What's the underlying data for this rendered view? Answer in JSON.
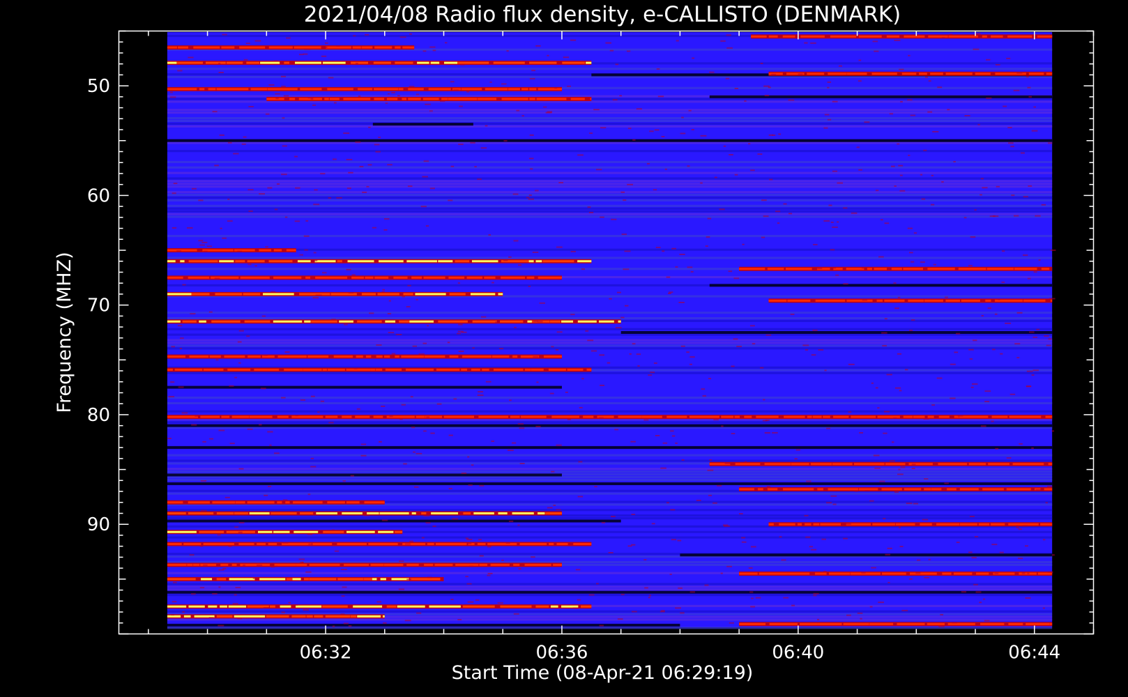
{
  "chart_data": {
    "type": "heatmap",
    "title": "2021/04/08  Radio flux density, e-CALLISTO (DENMARK)",
    "xlabel": "Start Time (08-Apr-21 06:29:19)",
    "ylabel": "Frequency (MHZ)",
    "x_ticks": [
      "06:32",
      "06:36",
      "06:40",
      "06:44"
    ],
    "x_tick_minutes": [
      32,
      36,
      40,
      44
    ],
    "xlim_minutes": [
      28.5,
      45.0
    ],
    "data_range_minutes": [
      29.32,
      44.3
    ],
    "y_ticks": [
      50,
      60,
      70,
      80,
      90
    ],
    "ylim": [
      45.0,
      100.0
    ],
    "data_range_mhz": [
      45.1,
      99.4
    ],
    "y_inverted": true,
    "colormap": [
      "#000000",
      "#0000ff",
      "#ff0000",
      "#ffff00",
      "#ffffff"
    ],
    "background_color": "#2a18ff",
    "bright_bands": [
      {
        "freq_mhz": 45.5,
        "time_range_min": [
          39.2,
          44.3
        ],
        "intensity": 0.8
      },
      {
        "freq_mhz": 46.5,
        "time_range_min": [
          29.32,
          33.5
        ],
        "intensity": 0.85
      },
      {
        "freq_mhz": 47.9,
        "time_range_min": [
          29.32,
          36.5
        ],
        "intensity": 0.95
      },
      {
        "freq_mhz": 50.3,
        "time_range_min": [
          29.32,
          36.0
        ],
        "intensity": 0.85
      },
      {
        "freq_mhz": 51.2,
        "time_range_min": [
          31.0,
          36.5
        ],
        "intensity": 0.7
      },
      {
        "freq_mhz": 48.9,
        "time_range_min": [
          39.5,
          44.3
        ],
        "intensity": 0.7
      },
      {
        "freq_mhz": 65.0,
        "time_range_min": [
          29.32,
          31.5
        ],
        "intensity": 0.85
      },
      {
        "freq_mhz": 66.0,
        "time_range_min": [
          29.32,
          36.5
        ],
        "intensity": 0.95
      },
      {
        "freq_mhz": 66.7,
        "time_range_min": [
          39.0,
          44.3
        ],
        "intensity": 0.8
      },
      {
        "freq_mhz": 67.5,
        "time_range_min": [
          29.32,
          36.0
        ],
        "intensity": 0.7
      },
      {
        "freq_mhz": 69.0,
        "time_range_min": [
          29.32,
          35.0
        ],
        "intensity": 0.9
      },
      {
        "freq_mhz": 69.6,
        "time_range_min": [
          39.5,
          44.3
        ],
        "intensity": 0.85
      },
      {
        "freq_mhz": 71.5,
        "time_range_min": [
          29.32,
          37.0
        ],
        "intensity": 0.95
      },
      {
        "freq_mhz": 74.7,
        "time_range_min": [
          29.32,
          36.0
        ],
        "intensity": 0.7
      },
      {
        "freq_mhz": 75.9,
        "time_range_min": [
          29.32,
          36.5
        ],
        "intensity": 0.85
      },
      {
        "freq_mhz": 80.2,
        "time_range_min": [
          29.32,
          44.3
        ],
        "intensity": 0.6
      },
      {
        "freq_mhz": 84.5,
        "time_range_min": [
          38.5,
          44.3
        ],
        "intensity": 0.75
      },
      {
        "freq_mhz": 86.8,
        "time_range_min": [
          39.0,
          44.3
        ],
        "intensity": 0.7
      },
      {
        "freq_mhz": 88.0,
        "time_range_min": [
          29.32,
          33.0
        ],
        "intensity": 0.7
      },
      {
        "freq_mhz": 89.0,
        "time_range_min": [
          29.32,
          36.0
        ],
        "intensity": 0.95
      },
      {
        "freq_mhz": 90.0,
        "time_range_min": [
          39.5,
          44.3
        ],
        "intensity": 0.8
      },
      {
        "freq_mhz": 90.7,
        "time_range_min": [
          29.32,
          33.3
        ],
        "intensity": 1.0
      },
      {
        "freq_mhz": 91.8,
        "time_range_min": [
          29.32,
          36.5
        ],
        "intensity": 0.75
      },
      {
        "freq_mhz": 93.7,
        "time_range_min": [
          29.32,
          36.0
        ],
        "intensity": 0.85
      },
      {
        "freq_mhz": 94.5,
        "time_range_min": [
          39.0,
          44.3
        ],
        "intensity": 0.75
      },
      {
        "freq_mhz": 95.0,
        "time_range_min": [
          29.32,
          34.0
        ],
        "intensity": 0.95
      },
      {
        "freq_mhz": 97.5,
        "time_range_min": [
          29.32,
          36.5
        ],
        "intensity": 0.9
      },
      {
        "freq_mhz": 98.4,
        "time_range_min": [
          29.32,
          33.0
        ],
        "intensity": 1.0
      },
      {
        "freq_mhz": 99.1,
        "time_range_min": [
          39.0,
          44.3
        ],
        "intensity": 0.8
      }
    ],
    "dark_bands": [
      {
        "freq_mhz": 49.0,
        "time_range_min": [
          36.5,
          44.3
        ]
      },
      {
        "freq_mhz": 51.0,
        "time_range_min": [
          38.5,
          44.3
        ]
      },
      {
        "freq_mhz": 53.5,
        "time_range_min": [
          32.8,
          34.5
        ]
      },
      {
        "freq_mhz": 55.0,
        "time_range_min": [
          29.32,
          44.3
        ]
      },
      {
        "freq_mhz": 68.2,
        "time_range_min": [
          38.5,
          44.3
        ]
      },
      {
        "freq_mhz": 72.5,
        "time_range_min": [
          37.0,
          44.3
        ]
      },
      {
        "freq_mhz": 77.5,
        "time_range_min": [
          29.32,
          36.0
        ]
      },
      {
        "freq_mhz": 81.0,
        "time_range_min": [
          29.32,
          44.3
        ]
      },
      {
        "freq_mhz": 83.0,
        "time_range_min": [
          29.32,
          44.3
        ]
      },
      {
        "freq_mhz": 85.5,
        "time_range_min": [
          29.32,
          36.0
        ]
      },
      {
        "freq_mhz": 86.3,
        "time_range_min": [
          29.32,
          44.3
        ]
      },
      {
        "freq_mhz": 89.7,
        "time_range_min": [
          29.32,
          37.0
        ]
      },
      {
        "freq_mhz": 92.8,
        "time_range_min": [
          38.0,
          44.3
        ]
      },
      {
        "freq_mhz": 96.2,
        "time_range_min": [
          29.32,
          44.3
        ]
      },
      {
        "freq_mhz": 99.2,
        "time_range_min": [
          29.32,
          38.0
        ]
      }
    ]
  }
}
